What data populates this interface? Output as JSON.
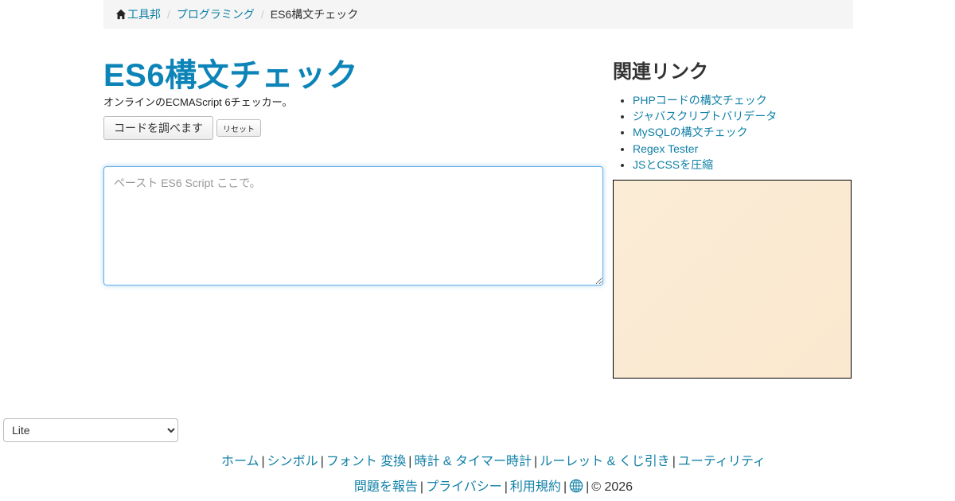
{
  "breadcrumb": {
    "home": "工具邦",
    "category": "プログラミング",
    "current": "ES6構文チェック"
  },
  "main": {
    "title": "ES6構文チェック",
    "subtitle": "オンラインのECMAScript 6チェッカー。",
    "check_button": "コードを調べます",
    "reset_button": "リセット",
    "code_placeholder": "ペースト ES6 Script ここで。",
    "code_value": ""
  },
  "sidebar": {
    "title": "関連リンク",
    "links": [
      "PHPコードの構文チェック",
      "ジャバスクリプトバリデータ",
      "MySQLの構文チェック",
      "Regex Tester",
      "JSとCSSを圧縮"
    ]
  },
  "theme_select": {
    "selected": "Lite"
  },
  "footer": {
    "row1": [
      "ホーム",
      "シンボル",
      "フォント 変換",
      "時計 & タイマー時計",
      "ルーレット & くじ引き",
      "ユーティリティ"
    ],
    "row2": [
      "問題を報告",
      "プライバシー",
      "利用規約"
    ],
    "copyright": "© 2026"
  },
  "colors": {
    "accent": "#0d84b8",
    "link": "#0f7fa6",
    "ad_background": "#fbe9d2"
  }
}
